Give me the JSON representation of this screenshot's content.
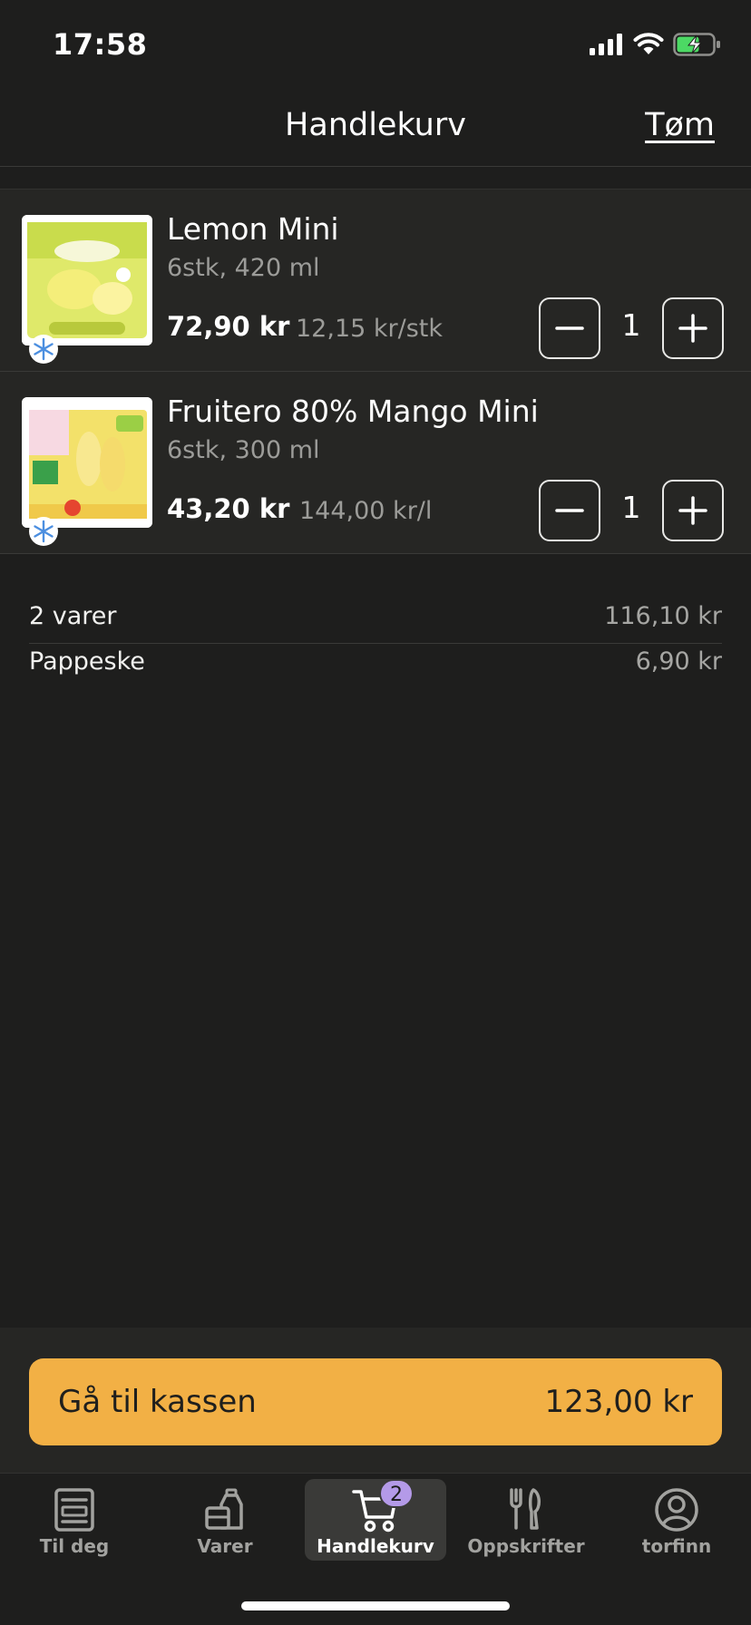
{
  "status_bar": {
    "time": "17:58"
  },
  "header": {
    "title": "Handlekurv",
    "clear_label": "Tøm"
  },
  "cart": {
    "items": [
      {
        "name": "Lemon Mini",
        "size": "6stk, 420 ml",
        "price": "72,90 kr",
        "unit_price": "12,15 kr/stk",
        "quantity": "1"
      },
      {
        "name": "Fruitero 80% Mango Mini",
        "size": "6stk, 300 ml",
        "price": "43,20 kr",
        "unit_price": "144,00 kr/l",
        "quantity": "1"
      }
    ]
  },
  "summary": {
    "rows": [
      {
        "label": "2 varer",
        "value": "116,10 kr"
      },
      {
        "label": "Pappeske",
        "value": "6,90 kr"
      }
    ]
  },
  "checkout": {
    "label": "Gå til kassen",
    "total": "123,00 kr"
  },
  "tab_bar": {
    "tabs": [
      {
        "label": "Til deg",
        "icon": "newspaper-icon"
      },
      {
        "label": "Varer",
        "icon": "grocery-bag-icon"
      },
      {
        "label": "Handlekurv",
        "icon": "cart-icon",
        "badge": "2",
        "active": true
      },
      {
        "label": "Oppskrifter",
        "icon": "fork-knife-icon"
      },
      {
        "label": "torfinn",
        "icon": "profile-icon"
      }
    ]
  },
  "colors": {
    "background": "#1e1e1d",
    "accent": "#f2b045",
    "badge": "#b49ae8"
  }
}
